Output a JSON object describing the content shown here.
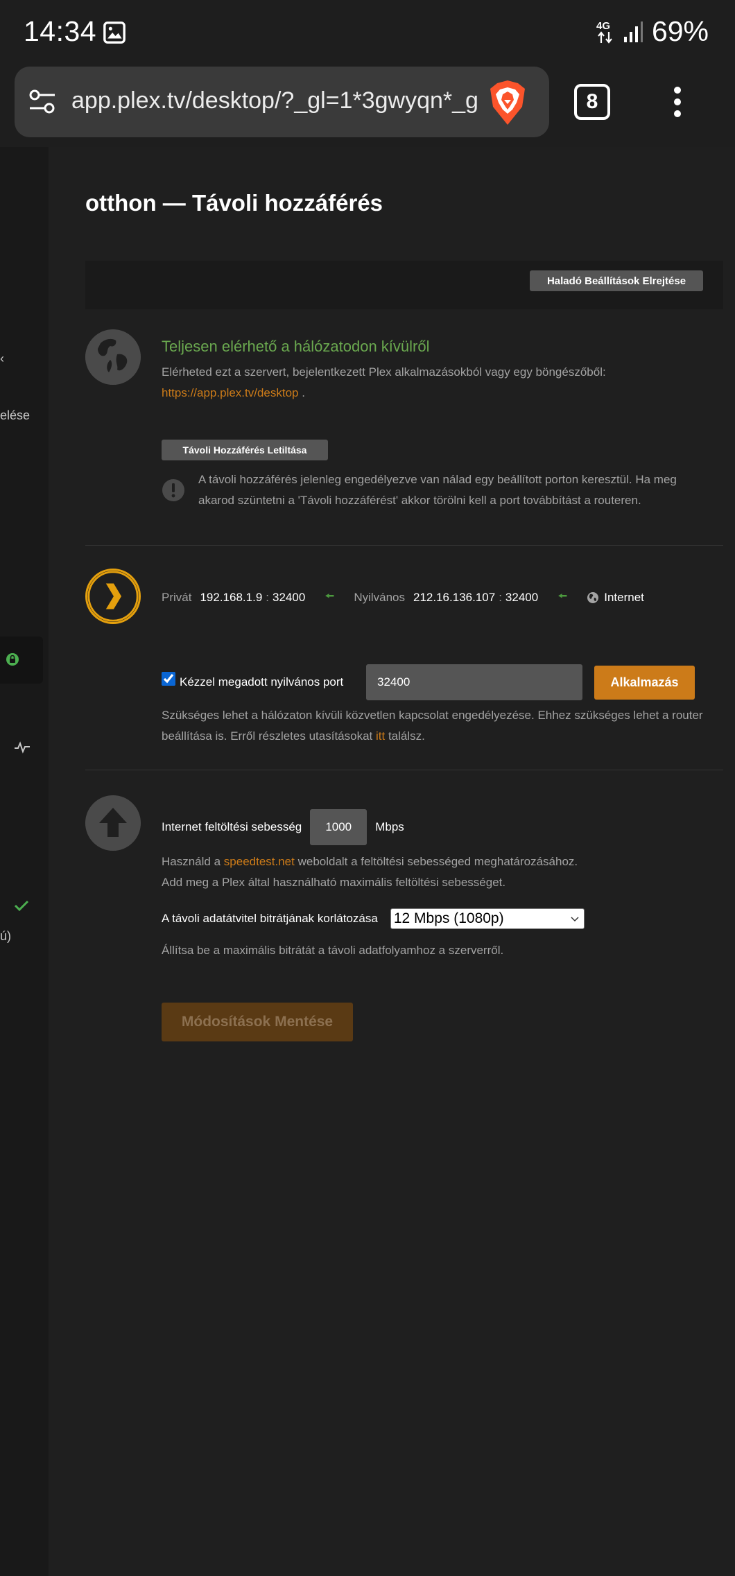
{
  "status_bar": {
    "time": "14:34",
    "network": "4G",
    "battery": "69%",
    "icons": [
      "gallery-icon",
      "network-4g-icon",
      "signal-icon"
    ]
  },
  "browser": {
    "url": "app.plex.tv/desktop/?_gl=1*3gwyqn*_g",
    "tab_count": "8",
    "icons": [
      "tune-icon",
      "brave-lion-icon",
      "kebab-menu-icon"
    ]
  },
  "leftnav": {
    "partial_labels": [
      "‹",
      "elése",
      "ú)"
    ]
  },
  "page": {
    "title": "otthon — Távoli hozzáférés",
    "advanced_button": "Haladó Beállítások Elrejtése"
  },
  "status": {
    "title": "Teljesen elérhető a hálózatodon kívülről",
    "description": "Elérheted ezt a szervert, bejelentkezett Plex alkalmazásokból vagy egy böngészőből:",
    "link": "https://app.plex.tv/desktop",
    "link_suffix": " .",
    "disable_button": "Távoli Hozzáférés Letiltása",
    "info_text": "A távoli hozzáférés jelenleg engedélyezve van nálad egy beállított porton keresztül. Ha meg akarod szüntetni a 'Távoli hozzáférést' akkor törölni kell a port továbbítást a routeren."
  },
  "connection": {
    "private_label": "Privát",
    "private_ip": "192.168.1.9",
    "private_port": "32400",
    "public_label": "Nyilvános",
    "public_ip": "212.16.136.107",
    "public_port": "32400",
    "separator": ":",
    "internet_label": "Internet"
  },
  "manual_port": {
    "checked": true,
    "label": "Kézzel megadott nyilvános port",
    "value": "32400",
    "apply_button": "Alkalmazás",
    "help_before": "Szükséges lehet a hálózaton kívüli közvetlen kapcsolat engedélyezése. Ehhez szükséges lehet a router beállítása is. Erről részletes utasításokat ",
    "help_link": "itt",
    "help_after": " találsz."
  },
  "upload": {
    "label": "Internet feltöltési sebesség",
    "value": "1000",
    "unit": "Mbps",
    "help_line1_before": "Használd a ",
    "help_line1_link": "speedtest.net",
    "help_line1_after": " weboldalt a feltöltési sebességed meghatározásához.",
    "help_line2": "Add meg a Plex által használható maximális feltöltési sebességet."
  },
  "bitrate": {
    "label": "A távoli adatátvitel bitrátjának korlátozása",
    "selected": "12 Mbps (1080p)",
    "help": "Állítsa be a maximális bitrátát a távoli adatfolyamhoz a szerverről."
  },
  "save_button": "Módosítások Mentése",
  "colors": {
    "accent": "#cc7b19",
    "success": "#6aa84f",
    "plex_yellow": "#e5a00d",
    "background": "#1f1f1f"
  }
}
